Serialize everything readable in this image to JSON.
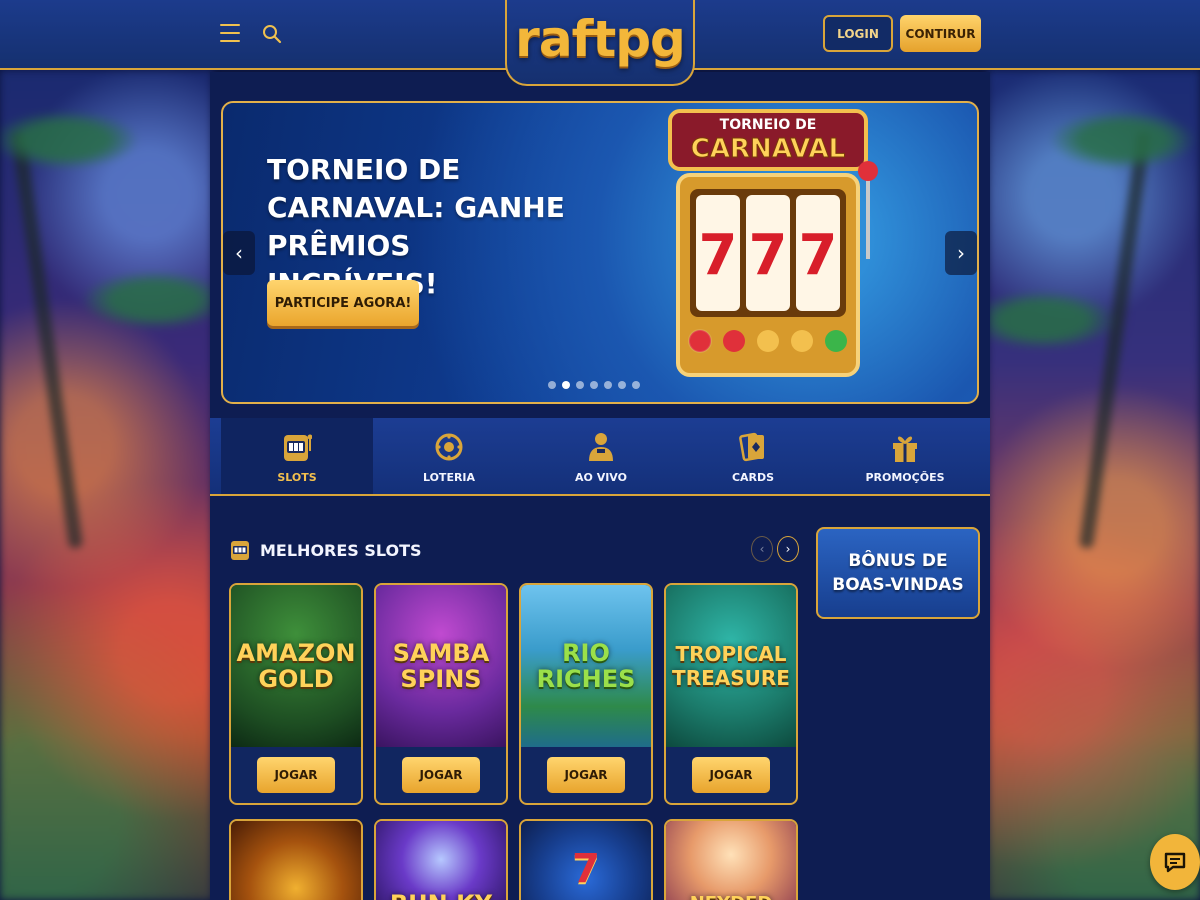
{
  "header": {
    "logo": "raftpg",
    "login_label": "LOGIN",
    "signup_label": "CONTIRUR"
  },
  "hero": {
    "title": "TORNEIO DE CARNAVAL: GANHE PRÊMIOS INCRÍVEIS!",
    "cta_label": "PARTICIPE AGORA!",
    "sign_top": "TORNEIO DE",
    "sign_main": "CARNAVAL",
    "reels": [
      "7",
      "7",
      "7"
    ],
    "slide_count": 7,
    "active_slide": 1
  },
  "tabs": [
    {
      "label": "SLOTS",
      "icon": "slot-machine-icon",
      "active": true
    },
    {
      "label": "LOTERIA",
      "icon": "lottery-ball-icon",
      "active": false
    },
    {
      "label": "AO VIVO",
      "icon": "live-dealer-icon",
      "active": false
    },
    {
      "label": "CARDS",
      "icon": "cards-icon",
      "active": false
    },
    {
      "label": "PROMOÇÕES",
      "icon": "gift-icon",
      "active": false
    }
  ],
  "slots_section": {
    "title": "MELHORES SLOTS",
    "icon": "slot-machine-icon",
    "prev_icon": "chevron-left-icon",
    "next_icon": "chevron-right-icon",
    "play_label": "JOGAR",
    "games": [
      {
        "name": "AMAZON GOLD",
        "line1": "AMAZON",
        "line2": "GOLD"
      },
      {
        "name": "SAMBA SPINS",
        "line1": "SAMBA",
        "line2": "SPINS"
      },
      {
        "name": "RIO RICHES",
        "line1": "RIO",
        "line2": "RICHES"
      },
      {
        "name": "TROPICAL TREASURE",
        "line1": "TROPICAL",
        "line2": "TREASURE"
      }
    ],
    "games_row2": [
      {
        "line1": ""
      },
      {
        "line1": "BUN KY"
      },
      {
        "line1": "7"
      },
      {
        "line1": "NEYDED"
      }
    ]
  },
  "bonus": {
    "line1": "BÔNUS DE",
    "line2": "BOAS-VINDAS"
  },
  "colors": {
    "gold": "#d9a53a",
    "navy": "#0e1d52",
    "button_gold": "#f2b53a"
  }
}
